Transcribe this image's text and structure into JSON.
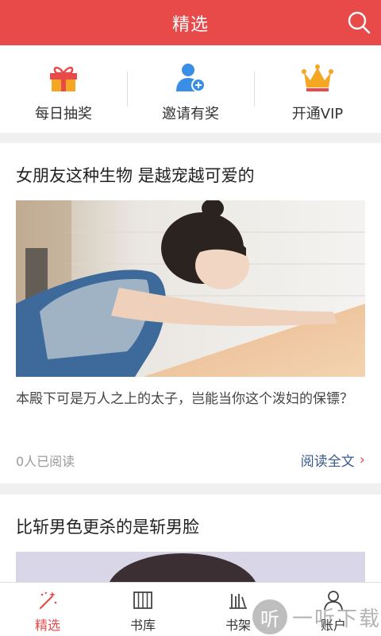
{
  "header": {
    "title": "精选"
  },
  "quick_actions": [
    {
      "label": "每日抽奖",
      "icon": "gift-icon"
    },
    {
      "label": "邀请有奖",
      "icon": "add-user-icon"
    },
    {
      "label": "开通VIP",
      "icon": "crown-icon"
    }
  ],
  "articles": [
    {
      "title": "女朋友这种生物 是越宠越可爱的",
      "description": "本殿下可是万人之上的太子，岂能当你这个泼妇的保镖？",
      "read_count": "0人已阅读",
      "read_more": "阅读全文"
    },
    {
      "title": "比斩男色更杀的是斩男脸"
    }
  ],
  "bottom_nav": [
    {
      "label": "精选",
      "icon": "magic-wand-icon",
      "active": true
    },
    {
      "label": "书库",
      "icon": "library-icon"
    },
    {
      "label": "书架",
      "icon": "bookshelf-icon"
    },
    {
      "label": "账户",
      "icon": "user-icon"
    }
  ],
  "watermark": {
    "glyph": "听",
    "text": "一听下载"
  },
  "colors": {
    "brand": "#e84a4a",
    "link": "#3a5a8c",
    "vip": "#f5a623",
    "invite": "#3a8ee6"
  }
}
